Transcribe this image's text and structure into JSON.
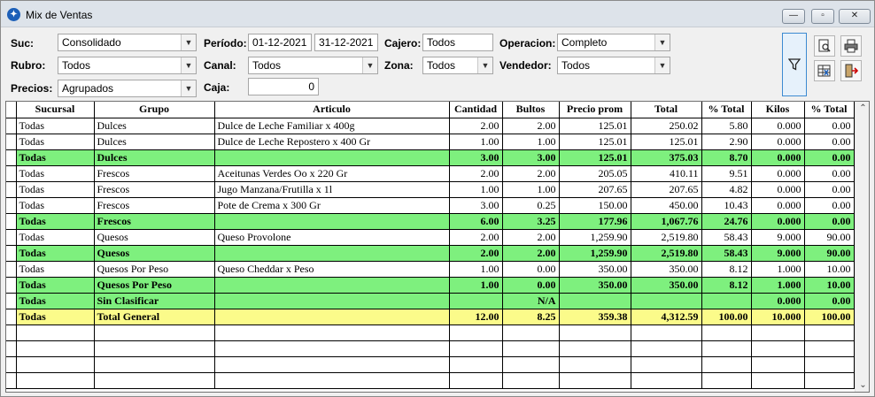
{
  "window": {
    "title": "Mix de Ventas",
    "minimize_glyph": "—",
    "maximize_glyph": "▫",
    "close_glyph": "✕"
  },
  "filters": {
    "suc_label": "Suc:",
    "suc_value": "Consolidado",
    "rubro_label": "Rubro:",
    "rubro_value": "Todos",
    "precios_label": "Precios:",
    "precios_value": "Agrupados",
    "periodo_label": "Período:",
    "periodo_desde": "01-12-2021",
    "periodo_hasta": "31-12-2021",
    "canal_label": "Canal:",
    "canal_value": "Todos",
    "caja_label": "Caja:",
    "caja_value": "0",
    "cajero_label": "Cajero:",
    "cajero_value": "Todos",
    "zona_label": "Zona:",
    "zona_value": "Todos",
    "operacion_label": "Operacion:",
    "operacion_value": "Completo",
    "vendedor_label": "Vendedor:",
    "vendedor_value": "Todos"
  },
  "icons": {
    "filter": "filter-icon",
    "preview": "print-preview-icon",
    "print": "printer-icon",
    "excel": "export-excel-icon",
    "exit": "exit-door-icon"
  },
  "colors": {
    "subtotal_row": "#7ef07e",
    "total_row": "#fbfb8a"
  },
  "table": {
    "headers": [
      "Sucursal",
      "Grupo",
      "Articulo",
      "Cantidad",
      "Bultos",
      "Precio prom",
      "Total",
      "% Total",
      "Kilos",
      "% Total"
    ],
    "rows": [
      {
        "type": "normal",
        "cells": [
          "Todas",
          "Dulces",
          "Dulce de Leche Familiar x 400g",
          "2.00",
          "2.00",
          "125.01",
          "250.02",
          "5.80",
          "0.000",
          "0.00"
        ]
      },
      {
        "type": "normal",
        "cells": [
          "Todas",
          "Dulces",
          "Dulce de Leche Repostero x 400 Gr",
          "1.00",
          "1.00",
          "125.01",
          "125.01",
          "2.90",
          "0.000",
          "0.00"
        ]
      },
      {
        "type": "subtotal",
        "cells": [
          "Todas",
          "Dulces",
          "",
          "3.00",
          "3.00",
          "125.01",
          "375.03",
          "8.70",
          "0.000",
          "0.00"
        ]
      },
      {
        "type": "normal",
        "cells": [
          "Todas",
          "Frescos",
          "Aceitunas Verdes Oo x 220 Gr",
          "2.00",
          "2.00",
          "205.05",
          "410.11",
          "9.51",
          "0.000",
          "0.00"
        ]
      },
      {
        "type": "normal",
        "cells": [
          "Todas",
          "Frescos",
          "Jugo Manzana/Frutilla x 1l",
          "1.00",
          "1.00",
          "207.65",
          "207.65",
          "4.82",
          "0.000",
          "0.00"
        ]
      },
      {
        "type": "normal",
        "cells": [
          "Todas",
          "Frescos",
          "Pote de Crema x 300 Gr",
          "3.00",
          "0.25",
          "150.00",
          "450.00",
          "10.43",
          "0.000",
          "0.00"
        ]
      },
      {
        "type": "subtotal",
        "cells": [
          "Todas",
          "Frescos",
          "",
          "6.00",
          "3.25",
          "177.96",
          "1,067.76",
          "24.76",
          "0.000",
          "0.00"
        ]
      },
      {
        "type": "normal",
        "cells": [
          "Todas",
          "Quesos",
          "Queso Provolone",
          "2.00",
          "2.00",
          "1,259.90",
          "2,519.80",
          "58.43",
          "9.000",
          "90.00"
        ]
      },
      {
        "type": "subtotal",
        "cells": [
          "Todas",
          "Quesos",
          "",
          "2.00",
          "2.00",
          "1,259.90",
          "2,519.80",
          "58.43",
          "9.000",
          "90.00"
        ]
      },
      {
        "type": "normal",
        "cells": [
          "Todas",
          "Quesos Por Peso",
          "Queso Cheddar x Peso",
          "1.00",
          "0.00",
          "350.00",
          "350.00",
          "8.12",
          "1.000",
          "10.00"
        ]
      },
      {
        "type": "subtotal",
        "cells": [
          "Todas",
          "Quesos Por Peso",
          "",
          "1.00",
          "0.00",
          "350.00",
          "350.00",
          "8.12",
          "1.000",
          "10.00"
        ]
      },
      {
        "type": "subtotal",
        "cells": [
          "Todas",
          "Sin Clasificar",
          "",
          "",
          "N/A",
          "",
          "",
          "",
          "0.000",
          "0.00"
        ]
      },
      {
        "type": "total",
        "cells": [
          "Todas",
          "Total General",
          "",
          "12.00",
          "8.25",
          "359.38",
          "4,312.59",
          "100.00",
          "10.000",
          "100.00"
        ]
      },
      {
        "type": "empty",
        "cells": [
          "",
          "",
          "",
          "",
          "",
          "",
          "",
          "",
          "",
          ""
        ]
      },
      {
        "type": "empty",
        "cells": [
          "",
          "",
          "",
          "",
          "",
          "",
          "",
          "",
          "",
          ""
        ]
      },
      {
        "type": "empty",
        "cells": [
          "",
          "",
          "",
          "",
          "",
          "",
          "",
          "",
          "",
          ""
        ]
      },
      {
        "type": "empty",
        "cells": [
          "",
          "",
          "",
          "",
          "",
          "",
          "",
          "",
          "",
          ""
        ]
      }
    ]
  },
  "scrollbar": {
    "up_glyph": "⌃",
    "down_glyph": "⌄"
  }
}
